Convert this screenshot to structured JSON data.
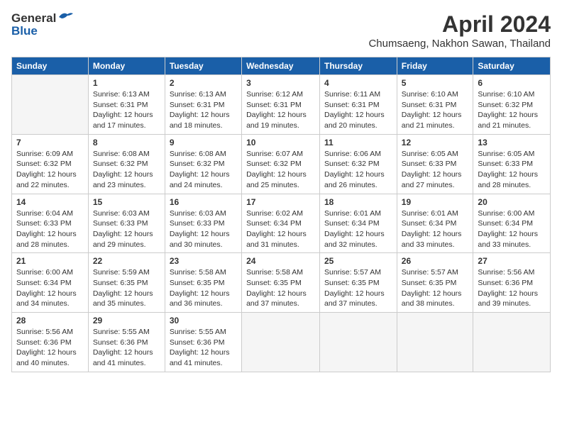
{
  "header": {
    "logo_general": "General",
    "logo_blue": "Blue",
    "month_title": "April 2024",
    "location": "Chumsaeng, Nakhon Sawan, Thailand"
  },
  "calendar": {
    "days_of_week": [
      "Sunday",
      "Monday",
      "Tuesday",
      "Wednesday",
      "Thursday",
      "Friday",
      "Saturday"
    ],
    "weeks": [
      [
        {
          "day": "",
          "info": ""
        },
        {
          "day": "1",
          "info": "Sunrise: 6:13 AM\nSunset: 6:31 PM\nDaylight: 12 hours\nand 17 minutes."
        },
        {
          "day": "2",
          "info": "Sunrise: 6:13 AM\nSunset: 6:31 PM\nDaylight: 12 hours\nand 18 minutes."
        },
        {
          "day": "3",
          "info": "Sunrise: 6:12 AM\nSunset: 6:31 PM\nDaylight: 12 hours\nand 19 minutes."
        },
        {
          "day": "4",
          "info": "Sunrise: 6:11 AM\nSunset: 6:31 PM\nDaylight: 12 hours\nand 20 minutes."
        },
        {
          "day": "5",
          "info": "Sunrise: 6:10 AM\nSunset: 6:31 PM\nDaylight: 12 hours\nand 21 minutes."
        },
        {
          "day": "6",
          "info": "Sunrise: 6:10 AM\nSunset: 6:32 PM\nDaylight: 12 hours\nand 21 minutes."
        }
      ],
      [
        {
          "day": "7",
          "info": "Sunrise: 6:09 AM\nSunset: 6:32 PM\nDaylight: 12 hours\nand 22 minutes."
        },
        {
          "day": "8",
          "info": "Sunrise: 6:08 AM\nSunset: 6:32 PM\nDaylight: 12 hours\nand 23 minutes."
        },
        {
          "day": "9",
          "info": "Sunrise: 6:08 AM\nSunset: 6:32 PM\nDaylight: 12 hours\nand 24 minutes."
        },
        {
          "day": "10",
          "info": "Sunrise: 6:07 AM\nSunset: 6:32 PM\nDaylight: 12 hours\nand 25 minutes."
        },
        {
          "day": "11",
          "info": "Sunrise: 6:06 AM\nSunset: 6:32 PM\nDaylight: 12 hours\nand 26 minutes."
        },
        {
          "day": "12",
          "info": "Sunrise: 6:05 AM\nSunset: 6:33 PM\nDaylight: 12 hours\nand 27 minutes."
        },
        {
          "day": "13",
          "info": "Sunrise: 6:05 AM\nSunset: 6:33 PM\nDaylight: 12 hours\nand 28 minutes."
        }
      ],
      [
        {
          "day": "14",
          "info": "Sunrise: 6:04 AM\nSunset: 6:33 PM\nDaylight: 12 hours\nand 28 minutes."
        },
        {
          "day": "15",
          "info": "Sunrise: 6:03 AM\nSunset: 6:33 PM\nDaylight: 12 hours\nand 29 minutes."
        },
        {
          "day": "16",
          "info": "Sunrise: 6:03 AM\nSunset: 6:33 PM\nDaylight: 12 hours\nand 30 minutes."
        },
        {
          "day": "17",
          "info": "Sunrise: 6:02 AM\nSunset: 6:34 PM\nDaylight: 12 hours\nand 31 minutes."
        },
        {
          "day": "18",
          "info": "Sunrise: 6:01 AM\nSunset: 6:34 PM\nDaylight: 12 hours\nand 32 minutes."
        },
        {
          "day": "19",
          "info": "Sunrise: 6:01 AM\nSunset: 6:34 PM\nDaylight: 12 hours\nand 33 minutes."
        },
        {
          "day": "20",
          "info": "Sunrise: 6:00 AM\nSunset: 6:34 PM\nDaylight: 12 hours\nand 33 minutes."
        }
      ],
      [
        {
          "day": "21",
          "info": "Sunrise: 6:00 AM\nSunset: 6:34 PM\nDaylight: 12 hours\nand 34 minutes."
        },
        {
          "day": "22",
          "info": "Sunrise: 5:59 AM\nSunset: 6:35 PM\nDaylight: 12 hours\nand 35 minutes."
        },
        {
          "day": "23",
          "info": "Sunrise: 5:58 AM\nSunset: 6:35 PM\nDaylight: 12 hours\nand 36 minutes."
        },
        {
          "day": "24",
          "info": "Sunrise: 5:58 AM\nSunset: 6:35 PM\nDaylight: 12 hours\nand 37 minutes."
        },
        {
          "day": "25",
          "info": "Sunrise: 5:57 AM\nSunset: 6:35 PM\nDaylight: 12 hours\nand 37 minutes."
        },
        {
          "day": "26",
          "info": "Sunrise: 5:57 AM\nSunset: 6:35 PM\nDaylight: 12 hours\nand 38 minutes."
        },
        {
          "day": "27",
          "info": "Sunrise: 5:56 AM\nSunset: 6:36 PM\nDaylight: 12 hours\nand 39 minutes."
        }
      ],
      [
        {
          "day": "28",
          "info": "Sunrise: 5:56 AM\nSunset: 6:36 PM\nDaylight: 12 hours\nand 40 minutes."
        },
        {
          "day": "29",
          "info": "Sunrise: 5:55 AM\nSunset: 6:36 PM\nDaylight: 12 hours\nand 41 minutes."
        },
        {
          "day": "30",
          "info": "Sunrise: 5:55 AM\nSunset: 6:36 PM\nDaylight: 12 hours\nand 41 minutes."
        },
        {
          "day": "",
          "info": ""
        },
        {
          "day": "",
          "info": ""
        },
        {
          "day": "",
          "info": ""
        },
        {
          "day": "",
          "info": ""
        }
      ]
    ]
  }
}
